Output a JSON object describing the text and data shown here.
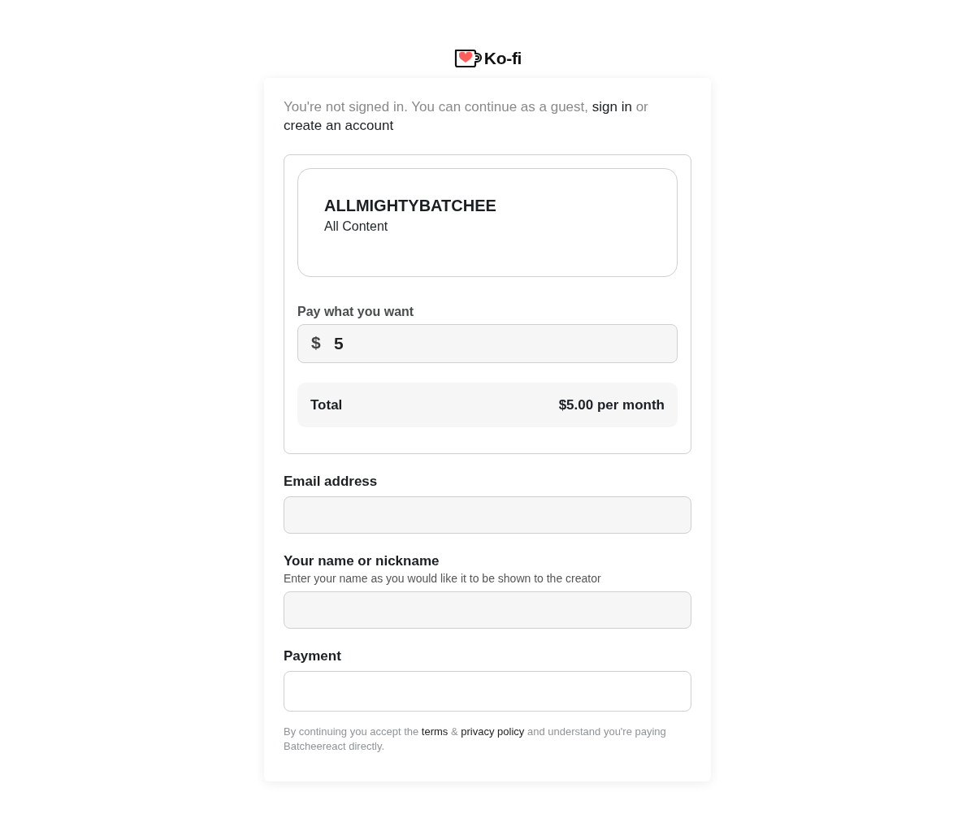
{
  "logo": {
    "text": "Ko-fi"
  },
  "notice": [
    {
      "kind": "plain",
      "text": "You're not signed in. You can continue as a guest,"
    },
    {
      "kind": "link",
      "text": "sign in"
    },
    {
      "kind": "plain",
      "text": "or"
    },
    {
      "kind": "link",
      "text": "create an account"
    }
  ],
  "tier": {
    "name": "ALLMIGHTYBATCHEE",
    "subtitle": "All Content"
  },
  "amount": {
    "label": "Pay what you want",
    "currency": "$",
    "value": "5"
  },
  "total": {
    "label": "Total",
    "value": "$5.00 per month"
  },
  "fields": [
    {
      "kind": "input",
      "label": "Email address"
    },
    {
      "kind": "input",
      "label": "Your name or nickname",
      "hint": "Enter your name as you would like it to be shown to the creator"
    },
    {
      "kind": "payment",
      "label": "Payment"
    }
  ],
  "legal": [
    {
      "kind": "plain",
      "text": "By continuing you accept the"
    },
    {
      "kind": "link",
      "text": "terms"
    },
    {
      "kind": "plain",
      "text": "&"
    },
    {
      "kind": "link",
      "text": "privacy policy"
    },
    {
      "kind": "plain",
      "text": "and understand you're paying Batcheereact directly."
    }
  ]
}
